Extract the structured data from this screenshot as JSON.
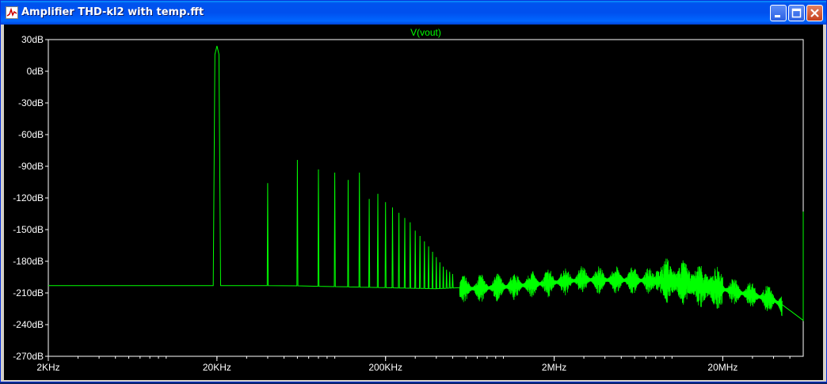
{
  "window": {
    "title": "Amplifier THD-kl2 with temp.fft"
  },
  "icons": {
    "app": "waveform-icon",
    "minimize": "minimize-icon",
    "maximize": "maximize-icon",
    "close": "close-icon"
  },
  "colors": {
    "trace": "#00ff00",
    "axis": "#ffffff",
    "background": "#000000",
    "title_bar": "#0053ee"
  },
  "chart_data": {
    "type": "line",
    "title": "V(vout)",
    "xlabel": "",
    "ylabel": "",
    "x_scale": "log",
    "xlim": [
      2000,
      60000000
    ],
    "ylim": [
      -270,
      30
    ],
    "x_ticks": [
      2000,
      20000,
      200000,
      2000000,
      20000000
    ],
    "x_tick_labels": [
      "2KHz",
      "20KHz",
      "200KHz",
      "2MHz",
      "20MHz"
    ],
    "y_ticks": [
      30,
      0,
      -30,
      -60,
      -90,
      -120,
      -150,
      -180,
      -210,
      -240,
      -270
    ],
    "y_tick_labels": [
      "30dB",
      "0dB",
      "-30dB",
      "-60dB",
      "-90dB",
      "-120dB",
      "-150dB",
      "-180dB",
      "-210dB",
      "-240dB",
      "-270dB"
    ],
    "grid": false,
    "series": [
      {
        "name": "V(vout)",
        "color": "#00ff00",
        "noise_floor": [
          [
            2000,
            -203
          ],
          [
            18000,
            -203
          ],
          [
            50000,
            -203
          ],
          [
            100000,
            -204
          ],
          [
            200000,
            -205
          ],
          [
            400000,
            -206
          ],
          [
            1000000,
            -203
          ],
          [
            3000000,
            -196
          ],
          [
            10000000,
            -197
          ],
          [
            20000000,
            -205
          ],
          [
            40000000,
            -215
          ],
          [
            60000000,
            -236
          ]
        ],
        "peaks": [
          {
            "f": 20000,
            "db": 24
          },
          {
            "f": 40000,
            "db": -106
          },
          {
            "f": 60000,
            "db": -84
          },
          {
            "f": 80000,
            "db": -93
          },
          {
            "f": 100000,
            "db": -96
          },
          {
            "f": 120000,
            "db": -103
          },
          {
            "f": 140000,
            "db": -96
          },
          {
            "f": 160000,
            "db": -121
          },
          {
            "f": 180000,
            "db": -116
          },
          {
            "f": 200000,
            "db": -124
          },
          {
            "f": 220000,
            "db": -129
          },
          {
            "f": 240000,
            "db": -134
          },
          {
            "f": 260000,
            "db": -139
          },
          {
            "f": 280000,
            "db": -143
          },
          {
            "f": 300000,
            "db": -151
          },
          {
            "f": 320000,
            "db": -156
          },
          {
            "f": 340000,
            "db": -161
          },
          {
            "f": 360000,
            "db": -166
          },
          {
            "f": 380000,
            "db": -171
          },
          {
            "f": 400000,
            "db": -176
          },
          {
            "f": 420000,
            "db": -181
          },
          {
            "f": 440000,
            "db": -185
          },
          {
            "f": 460000,
            "db": -188
          },
          {
            "f": 480000,
            "db": -190
          },
          {
            "f": 500000,
            "db": -192
          }
        ],
        "end_spike": {
          "f": 60000000,
          "db": -133
        }
      }
    ]
  }
}
